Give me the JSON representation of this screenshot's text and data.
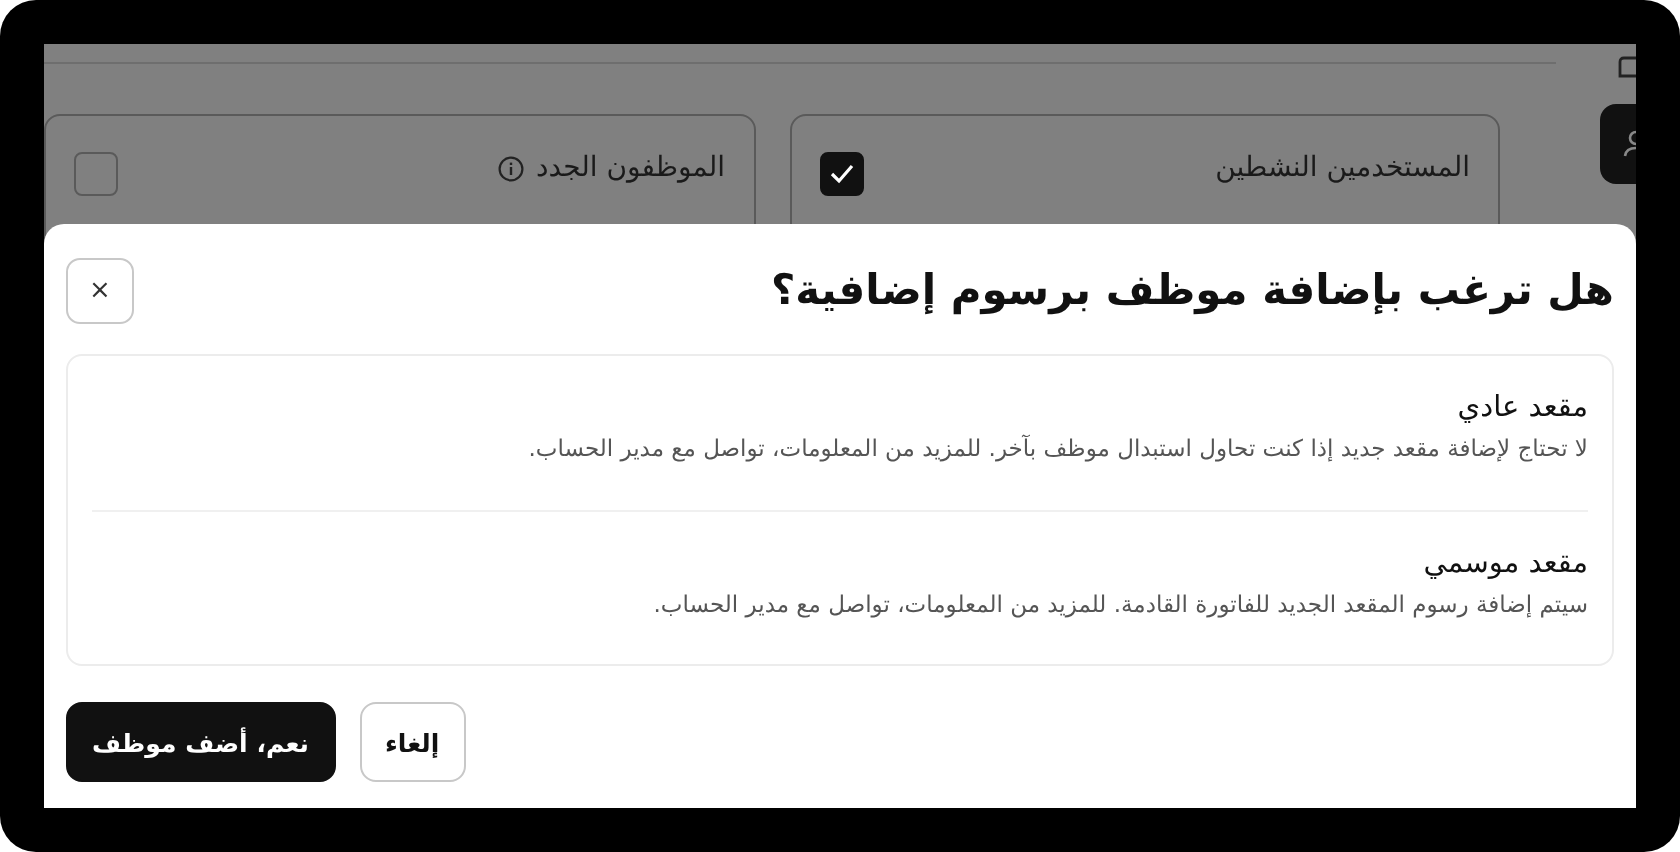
{
  "background": {
    "cards": [
      {
        "title": "المستخدمين النشطين",
        "checked": true,
        "info": false
      },
      {
        "title": "الموظفون الجدد",
        "checked": false,
        "info": true
      }
    ]
  },
  "dialog": {
    "title": "هل ترغب بإضافة موظف برسوم إضافية؟",
    "close": "×",
    "options": [
      {
        "title": "مقعد عادي",
        "description": "لا تحتاج لإضافة مقعد جديد إذا كنت تحاول استبدال موظف بآخر. للمزيد من المعلومات، تواصل مع مدير الحساب."
      },
      {
        "title": "مقعد موسمي",
        "description": "سيتم إضافة رسوم المقعد الجديد للفاتورة القادمة. للمزيد من المعلومات، تواصل مع مدير الحساب."
      }
    ],
    "buttons": [
      {
        "label": "إلغاء",
        "kind": "secondary"
      },
      {
        "label": "نعم، أضف موظف",
        "kind": "primary"
      }
    ]
  }
}
